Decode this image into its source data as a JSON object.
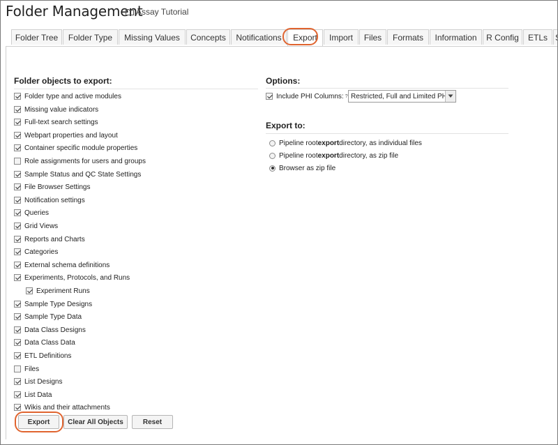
{
  "header": {
    "title": "Folder Management",
    "crumb": "Assay Tutorial",
    "crumb_icon": "folder-icon"
  },
  "tabs": [
    {
      "label": "Folder Tree",
      "active": false
    },
    {
      "label": "Folder Type",
      "active": false
    },
    {
      "label": "Missing Values",
      "active": false
    },
    {
      "label": "Concepts",
      "active": false
    },
    {
      "label": "Notifications",
      "active": false
    },
    {
      "label": "Export",
      "active": true
    },
    {
      "label": "Import",
      "active": false
    },
    {
      "label": "Files",
      "active": false
    },
    {
      "label": "Formats",
      "active": false
    },
    {
      "label": "Information",
      "active": false
    },
    {
      "label": "R Config",
      "active": false
    },
    {
      "label": "ETLs",
      "active": false
    },
    {
      "label": "S",
      "active": false
    }
  ],
  "objects": {
    "title": "Folder objects to export:",
    "items": [
      {
        "label": "Folder type and active modules",
        "checked": true
      },
      {
        "label": "Missing value indicators",
        "checked": true
      },
      {
        "label": "Full-text search settings",
        "checked": true
      },
      {
        "label": "Webpart properties and layout",
        "checked": true
      },
      {
        "label": "Container specific module properties",
        "checked": true
      },
      {
        "label": "Role assignments for users and groups",
        "checked": false
      },
      {
        "label": "Sample Status and QC State Settings",
        "checked": true
      },
      {
        "label": "File Browser Settings",
        "checked": true
      },
      {
        "label": "Notification settings",
        "checked": true
      },
      {
        "label": "Queries",
        "checked": true
      },
      {
        "label": "Grid Views",
        "checked": true
      },
      {
        "label": "Reports and Charts",
        "checked": true
      },
      {
        "label": "Categories",
        "checked": true
      },
      {
        "label": "External schema definitions",
        "checked": true
      },
      {
        "label": "Experiments, Protocols, and Runs",
        "checked": true
      },
      {
        "label": "Experiment Runs",
        "checked": true,
        "indent": true
      },
      {
        "label": "Sample Type Designs",
        "checked": true
      },
      {
        "label": "Sample Type Data",
        "checked": true
      },
      {
        "label": "Data Class Designs",
        "checked": true
      },
      {
        "label": "Data Class Data",
        "checked": true
      },
      {
        "label": "ETL Definitions",
        "checked": true
      },
      {
        "label": "Files",
        "checked": false
      },
      {
        "label": "List Designs",
        "checked": true
      },
      {
        "label": "List Data",
        "checked": true
      },
      {
        "label": "Wikis and their attachments",
        "checked": true
      }
    ]
  },
  "options": {
    "title": "Options:",
    "phi_label": "Include PHI Columns:",
    "phi_help": "?",
    "phi_checked": true,
    "phi_select_value": "Restricted, Full and Limited PHI"
  },
  "export_to": {
    "title": "Export to:",
    "choices": [
      {
        "before": "Pipeline root ",
        "bold": "export",
        "after": " directory, as individual files",
        "selected": false
      },
      {
        "before": "Pipeline root ",
        "bold": "export",
        "after": " directory, as zip file",
        "selected": false
      },
      {
        "before": "Browser as zip file",
        "bold": "",
        "after": "",
        "selected": true
      }
    ]
  },
  "buttons": {
    "export": "Export",
    "clear": "Clear All Objects",
    "reset": "Reset"
  },
  "accent_color": "#e0642f"
}
